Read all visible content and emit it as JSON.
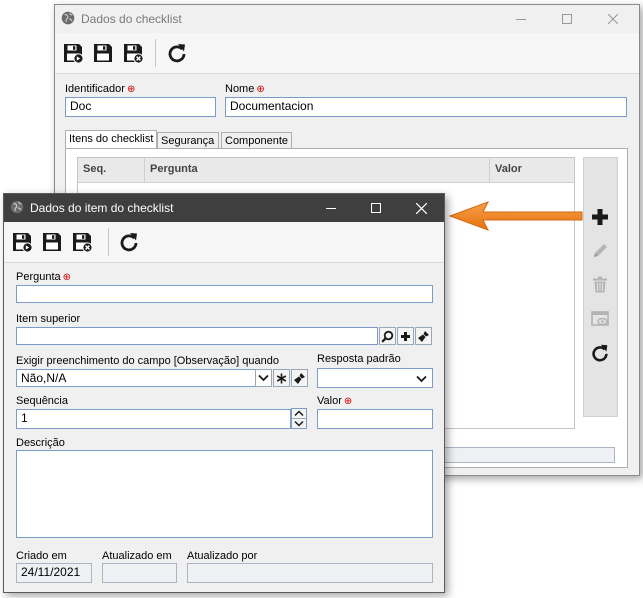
{
  "back_window": {
    "title": "Dados do checklist",
    "identificador_label": "Identificador",
    "identificador_value": "Doc",
    "nome_label": "Nome",
    "nome_value": "Documentacion",
    "tabs": [
      {
        "label": "Itens do checklist",
        "active": true
      },
      {
        "label": "Segurança",
        "active": false
      },
      {
        "label": "Componente",
        "active": false
      }
    ],
    "grid_columns": [
      "Seq.",
      "Pergunta",
      "Valor"
    ]
  },
  "front_window": {
    "title": "Dados do item do checklist",
    "pergunta_label": "Pergunta",
    "pergunta_value": "",
    "item_superior_label": "Item superior",
    "item_superior_value": "",
    "exigir_label": "Exigir preenchimento do campo [Observação] quando",
    "exigir_value": "Não,N/A",
    "resposta_label": "Resposta padrão",
    "resposta_value": "",
    "sequencia_label": "Sequência",
    "sequencia_value": "1",
    "valor_label": "Valor",
    "valor_value": "",
    "descricao_label": "Descrição",
    "descricao_value": "",
    "criado_label": "Criado em",
    "criado_value": "24/11/2021",
    "atualizado_em_label": "Atualizado em",
    "atualizado_em_value": "",
    "atualizado_por_label": "Atualizado por",
    "atualizado_por_value": ""
  },
  "required_mark": "⊕",
  "colors": {
    "arrow": "#f0861c",
    "input_border": "#7a9cc6",
    "required": "#d00000",
    "window_bg": "#f0f0f0"
  },
  "icons": [
    "save-new-icon",
    "save-icon",
    "save-close-icon",
    "refresh-icon",
    "add-icon",
    "edit-icon",
    "delete-icon",
    "view-icon",
    "search-icon",
    "clear-icon",
    "window-minimize-icon",
    "window-maximize-icon",
    "window-close-icon"
  ]
}
